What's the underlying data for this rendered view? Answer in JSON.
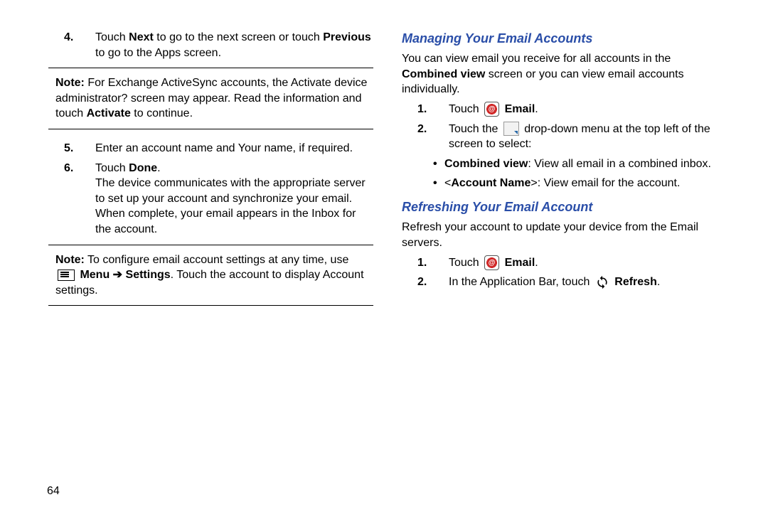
{
  "left": {
    "step4": "Touch Next to go to the next screen or touch Previous to go to the Apps screen.",
    "note1": "Note: For Exchange ActiveSync accounts, the Activate device administrator? screen may appear. Read the information and touch Activate to continue.",
    "step5": "Enter an account name and Your name, if required.",
    "step6a": "Touch Done.",
    "step6b": "The device communicates with the appropriate server to set up your account and synchronize your email. When complete, your email appears in the Inbox for the account.",
    "note2a": "Note: To configure email account settings at any time, use",
    "note2b": " Menu ➔ Settings. Touch the account to display Account settings."
  },
  "right": {
    "h1": "Managing Your Email Accounts",
    "p1a": "You can view email you receive for all accounts in the ",
    "p1b": "Combined view",
    "p1c": " screen or you can view email accounts individually.",
    "s1a": "Touch ",
    "s1b": " Email",
    "s1c": ".",
    "s2a": "Touch the ",
    "s2b": " drop-down menu at the top left of the screen to select:",
    "b1a": "Combined view",
    "b1b": ": View all email in a combined inbox.",
    "b2a": "<Account Name>",
    "b2b": ": View email for the account.",
    "h2": "Refreshing Your Email Account",
    "p2": "Refresh your account to update your device from the Email servers.",
    "r1a": "Touch ",
    "r1b": " Email",
    "r1c": ".",
    "r2a": "In the Application Bar, touch ",
    "r2b": " Refresh",
    "r2c": "."
  },
  "pagenum": "64"
}
